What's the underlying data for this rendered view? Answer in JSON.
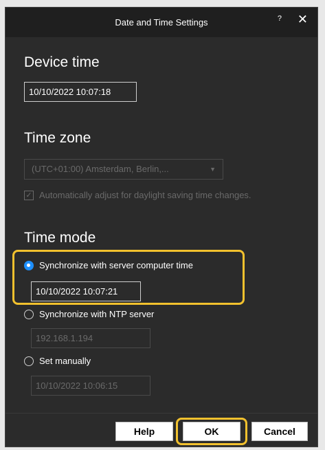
{
  "dialog": {
    "title": "Date and Time Settings",
    "help_glyph": "?",
    "close_glyph": "✕"
  },
  "device_time": {
    "heading": "Device time",
    "value": "10/10/2022 10:07:18"
  },
  "time_zone": {
    "heading": "Time zone",
    "selected": "(UTC+01:00) Amsterdam, Berlin,...",
    "auto_dst_label": "Automatically adjust for daylight saving time changes.",
    "auto_dst_checked": true
  },
  "time_mode": {
    "heading": "Time mode",
    "options": [
      {
        "label": "Synchronize with server computer time",
        "checked": true,
        "value": "10/10/2022 10:07:21"
      },
      {
        "label": "Synchronize with NTP server",
        "checked": false,
        "value": "192.168.1.194"
      },
      {
        "label": "Set manually",
        "checked": false,
        "value": "10/10/2022 10:06:15"
      }
    ]
  },
  "buttons": {
    "help": "Help",
    "ok": "OK",
    "cancel": "Cancel"
  },
  "colors": {
    "highlight": "#f2c12e",
    "radio_accent": "#1e90ff"
  },
  "icons": {
    "close": "close-icon",
    "help": "help-icon",
    "dropdown": "chevron-down-icon",
    "checkbox": "checkmark-icon"
  }
}
